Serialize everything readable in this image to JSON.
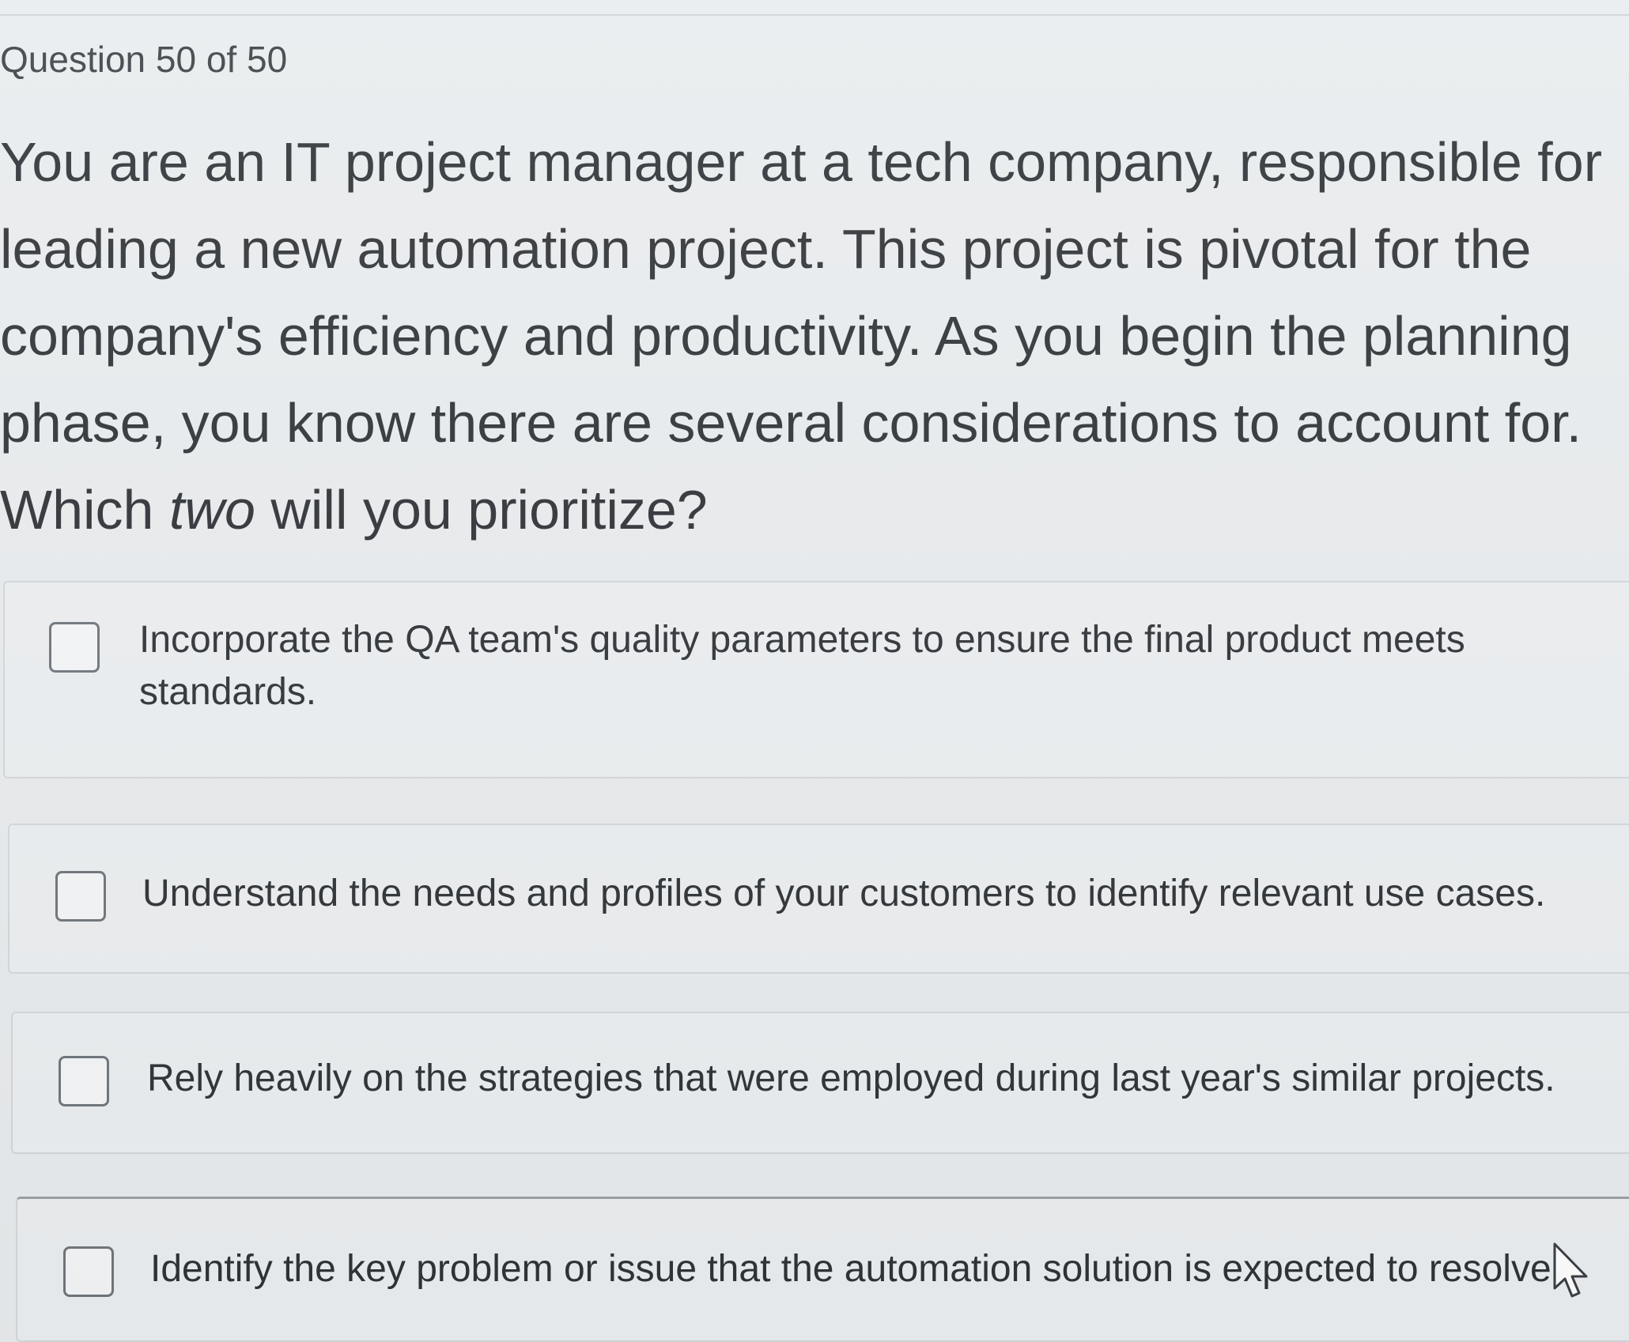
{
  "question": {
    "counter": "Question 50 of 50",
    "stem_lines": [
      "You are an IT project manager at a tech company, responsible for",
      "leading a new automation project. This project is pivotal for the",
      "company's efficiency and productivity. As you begin the planning",
      "phase, you know there are several considerations to account for."
    ],
    "stem_last_before": "Which ",
    "stem_last_emphasis": "two",
    "stem_last_after": " will you prioritize?"
  },
  "options": [
    {
      "label_line1": "Incorporate the QA team's quality parameters to ensure the final product meets",
      "label_line2": "standards.",
      "checked": false
    },
    {
      "label": "Understand the needs and profiles of your customers to identify relevant use cases.",
      "checked": false
    },
    {
      "label": "Rely heavily on the strategies that were employed during last year's similar projects.",
      "checked": false
    },
    {
      "label": "Identify the key problem or issue that the automation solution is expected to resolve.",
      "checked": false
    }
  ],
  "icons": {
    "checkbox": "checkbox-unchecked-icon",
    "cursor": "mouse-pointer-icon"
  },
  "colors": {
    "background": "#e9ecee",
    "text": "#2f3337",
    "checkbox_border": "#6f767c"
  }
}
